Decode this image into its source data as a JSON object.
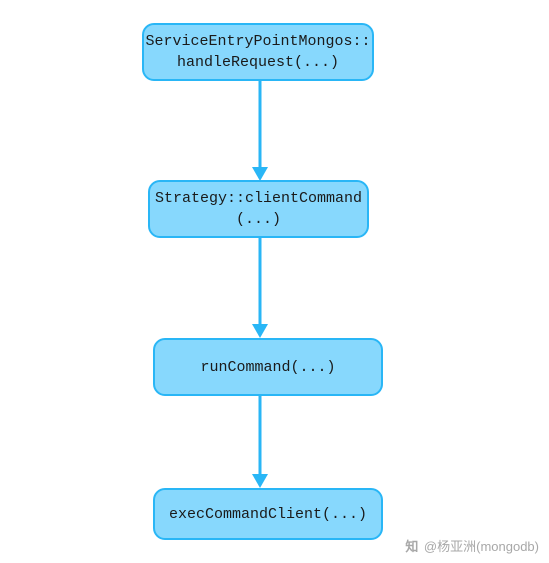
{
  "nodes": {
    "n1": {
      "label": "ServiceEntryPointMongos::\nhandleRequest(...)"
    },
    "n2": {
      "label": "Strategy::clientCommand\n(...)"
    },
    "n3": {
      "label": "runCommand(...)"
    },
    "n4": {
      "label": "execCommandClient(...)"
    }
  },
  "edges": [
    {
      "from": "n1",
      "to": "n2"
    },
    {
      "from": "n2",
      "to": "n3"
    },
    {
      "from": "n3",
      "to": "n4"
    }
  ],
  "watermark": {
    "prefix": "知",
    "text": "@杨亚洲(mongodb)"
  },
  "colors": {
    "node_fill": "#87d8fd",
    "node_border": "#29b6f6",
    "arrow": "#29b6f6"
  }
}
